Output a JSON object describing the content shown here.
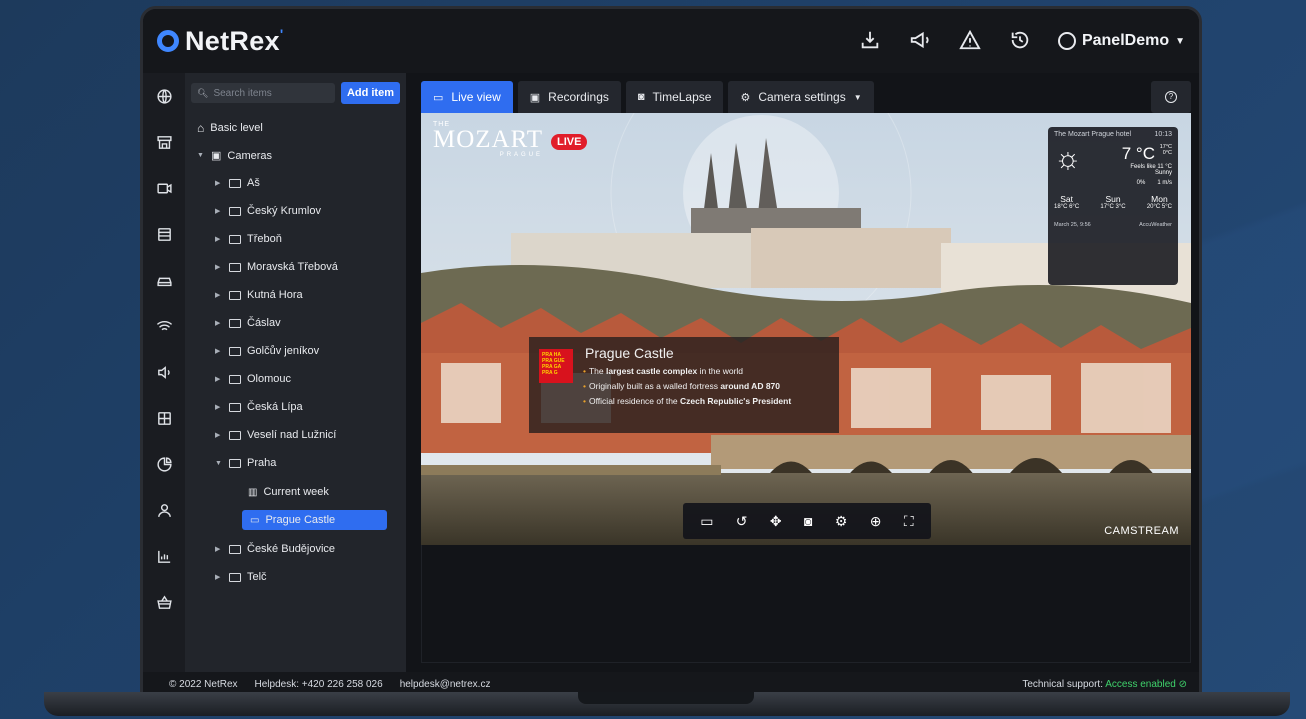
{
  "app": {
    "brand": "NetRex",
    "user": "PanelDemo"
  },
  "search": {
    "placeholder": "Search items"
  },
  "add_item_label": "Add item",
  "tree": {
    "basic_level": "Basic level",
    "cameras": "Cameras",
    "folders": [
      "Aš",
      "Český Krumlov",
      "Třeboň",
      "Moravská Třebová",
      "Kutná Hora",
      "Čáslav",
      "Golčův jeníkov",
      "Olomouc",
      "Česká Lípa",
      "Veselí nad Lužnicí",
      "Praha"
    ],
    "praha_children": {
      "current_week": "Current week",
      "prague_castle": "Prague Castle"
    },
    "folders_after": [
      "České Budějovice",
      "Telč"
    ]
  },
  "tabs": [
    {
      "label": "Live view",
      "icon": "video-icon"
    },
    {
      "label": "Recordings",
      "icon": "film-icon"
    },
    {
      "label": "TimeLapse",
      "icon": "camera-icon"
    },
    {
      "label": "Camera settings",
      "icon": "gear-icon"
    }
  ],
  "viewer": {
    "live_label": "LIVE",
    "mozart_top": "THE",
    "mozart_name": "MOZART",
    "mozart_sub": "PRAGUE",
    "info_title": "Prague Castle",
    "info_lines": [
      {
        "pre": "The ",
        "bold": "largest castle complex",
        "post": " in the world"
      },
      {
        "pre": "Originally built as a walled fortress ",
        "bold": "around AD 870",
        "post": ""
      },
      {
        "pre": "Official residence of the ",
        "bold": "Czech Republic's President",
        "post": ""
      }
    ],
    "praha_logo": "PRA HA PRA GUE PRA GA PRA G",
    "camstream": "CAMSTREAM",
    "weather": {
      "hotel": "The Mozart Prague hotel",
      "time": "10:13",
      "temp": "7 °C",
      "hi_lo": "17°C 0°C",
      "feels": "Feels like 11 °C",
      "condition": "Sunny",
      "precip": "0%",
      "wind": "1 m/s",
      "days": [
        {
          "day": "Sat",
          "hi": "18°C",
          "lo": "6°C"
        },
        {
          "day": "Sun",
          "hi": "17°C",
          "lo": "3°C"
        },
        {
          "day": "Mon",
          "hi": "20°C",
          "lo": "5°C"
        }
      ],
      "date": "March 25, 9:56",
      "provider": "AccuWeather"
    }
  },
  "footer": {
    "copyright": "© 2022 NetRex",
    "helpdesk_phone": "Helpdesk: +420 226 258 026",
    "helpdesk_email": "helpdesk@netrex.cz",
    "support_label": "Technical support:",
    "support_status": "Access enabled"
  },
  "colors": {
    "accent": "#2f6df0",
    "live": "#e11d2a",
    "ok": "#3fd26b"
  }
}
